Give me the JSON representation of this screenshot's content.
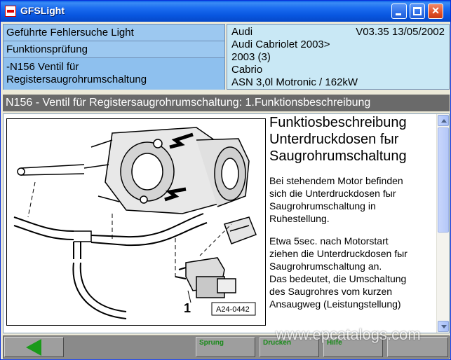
{
  "window": {
    "title": "GFSLight"
  },
  "nav": {
    "item1": "Geführte Fehlersuche Light",
    "item2": "Funktionsprüfung",
    "item3_line1": "-N156 Ventil  für",
    "item3_line2": "Registersaugrohrumschaltung"
  },
  "vehicle": {
    "make": "Audi",
    "version": "V03.35 13/05/2002",
    "model": "Audi Cabriolet 2003>",
    "year": "2003 (3)",
    "body": "Cabrio",
    "engine": "ASN 3,0l Motronic / 162kW"
  },
  "section": {
    "title": "N156 - Ventil für Registersaugrohrumschaltung: 1.Funktionsbeschreibung"
  },
  "diagram": {
    "part_label": "1",
    "figure_code": "A24-0442"
  },
  "description": {
    "heading_l1": "Funktiosbeschreibung",
    "heading_l2": "Unterdruckdosen fыr",
    "heading_l3": "Saugrohrumschaltung",
    "para1_l1": "Bei stehendem Motor befinden",
    "para1_l2": "sich die Unterdruckdosen fыr",
    "para1_l3": "Saugrohrumschaltung in",
    "para1_l4": "Ruhestellung.",
    "para2_l1": "Etwa 5sec. nach Motorstart",
    "para2_l2": "ziehen die Unterdruckdosen fыr",
    "para2_l3": "Saugrohrumschaltung an.",
    "para2_l4": "Das bedeutet, die Umschaltung",
    "para2_l5": "des Saugrohres vom kurzen",
    "para2_l6": "Ansaugweg (Leistungstellung)"
  },
  "toolbar": {
    "sprung": "Sprung",
    "drucken": "Drucken",
    "hilfe": "Hilfe"
  },
  "watermark": "www.epcatalogs.com",
  "colors": {
    "titlebar": "#0856e0",
    "nav_bg": "#9cc8f0",
    "vehicle_bg": "#c9e8f5",
    "section_bg": "#6a6a6a",
    "toolbar_bg": "#8a8a8a",
    "button_text": "#1a8a1a"
  }
}
